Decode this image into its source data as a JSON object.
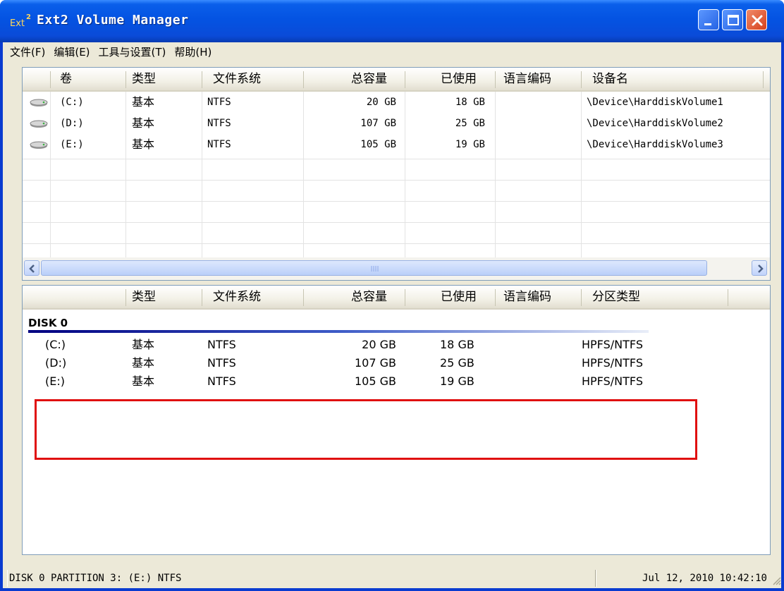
{
  "window": {
    "title": "Ext2 Volume Manager",
    "icon_text": "Ext",
    "icon_superscript": "2"
  },
  "menu": [
    "文件(F)",
    "编辑(E)",
    "工具与设置(T)",
    "帮助(H)"
  ],
  "volumes": {
    "columns": [
      "卷",
      "类型",
      "文件系统",
      "总容量",
      "已使用",
      "语言编码",
      "设备名"
    ],
    "rows": [
      {
        "volume": "(C:)",
        "type": "基本",
        "fs": "NTFS",
        "total": "20 GB",
        "used": "18 GB",
        "codepage": "",
        "device": "\\Device\\HarddiskVolume1"
      },
      {
        "volume": "(D:)",
        "type": "基本",
        "fs": "NTFS",
        "total": "107 GB",
        "used": "25 GB",
        "codepage": "",
        "device": "\\Device\\HarddiskVolume2"
      },
      {
        "volume": "(E:)",
        "type": "基本",
        "fs": "NTFS",
        "total": "105 GB",
        "used": "19 GB",
        "codepage": "",
        "device": "\\Device\\HarddiskVolume3"
      }
    ]
  },
  "partitions": {
    "columns": [
      "",
      "类型",
      "文件系统",
      "总容量",
      "已使用",
      "语言编码",
      "分区类型"
    ],
    "disk_label": "DISK 0",
    "rows": [
      {
        "volume": "(C:)",
        "type": "基本",
        "fs": "NTFS",
        "total": "20 GB",
        "used": "18 GB",
        "ptype": "HPFS/NTFS"
      },
      {
        "volume": "(D:)",
        "type": "基本",
        "fs": "NTFS",
        "total": "107 GB",
        "used": "25 GB",
        "ptype": "HPFS/NTFS"
      },
      {
        "volume": "(E:)",
        "type": "基本",
        "fs": "NTFS",
        "total": "105 GB",
        "used": "19 GB",
        "ptype": "HPFS/NTFS"
      }
    ]
  },
  "status": {
    "left": "DISK 0 PARTITION 3: (E:) NTFS",
    "right": "Jul 12, 2010 10:42:10"
  },
  "colors": {
    "titlebar": "#0453E2",
    "highlight_box": "#E01010",
    "disk_line": "#000080"
  }
}
